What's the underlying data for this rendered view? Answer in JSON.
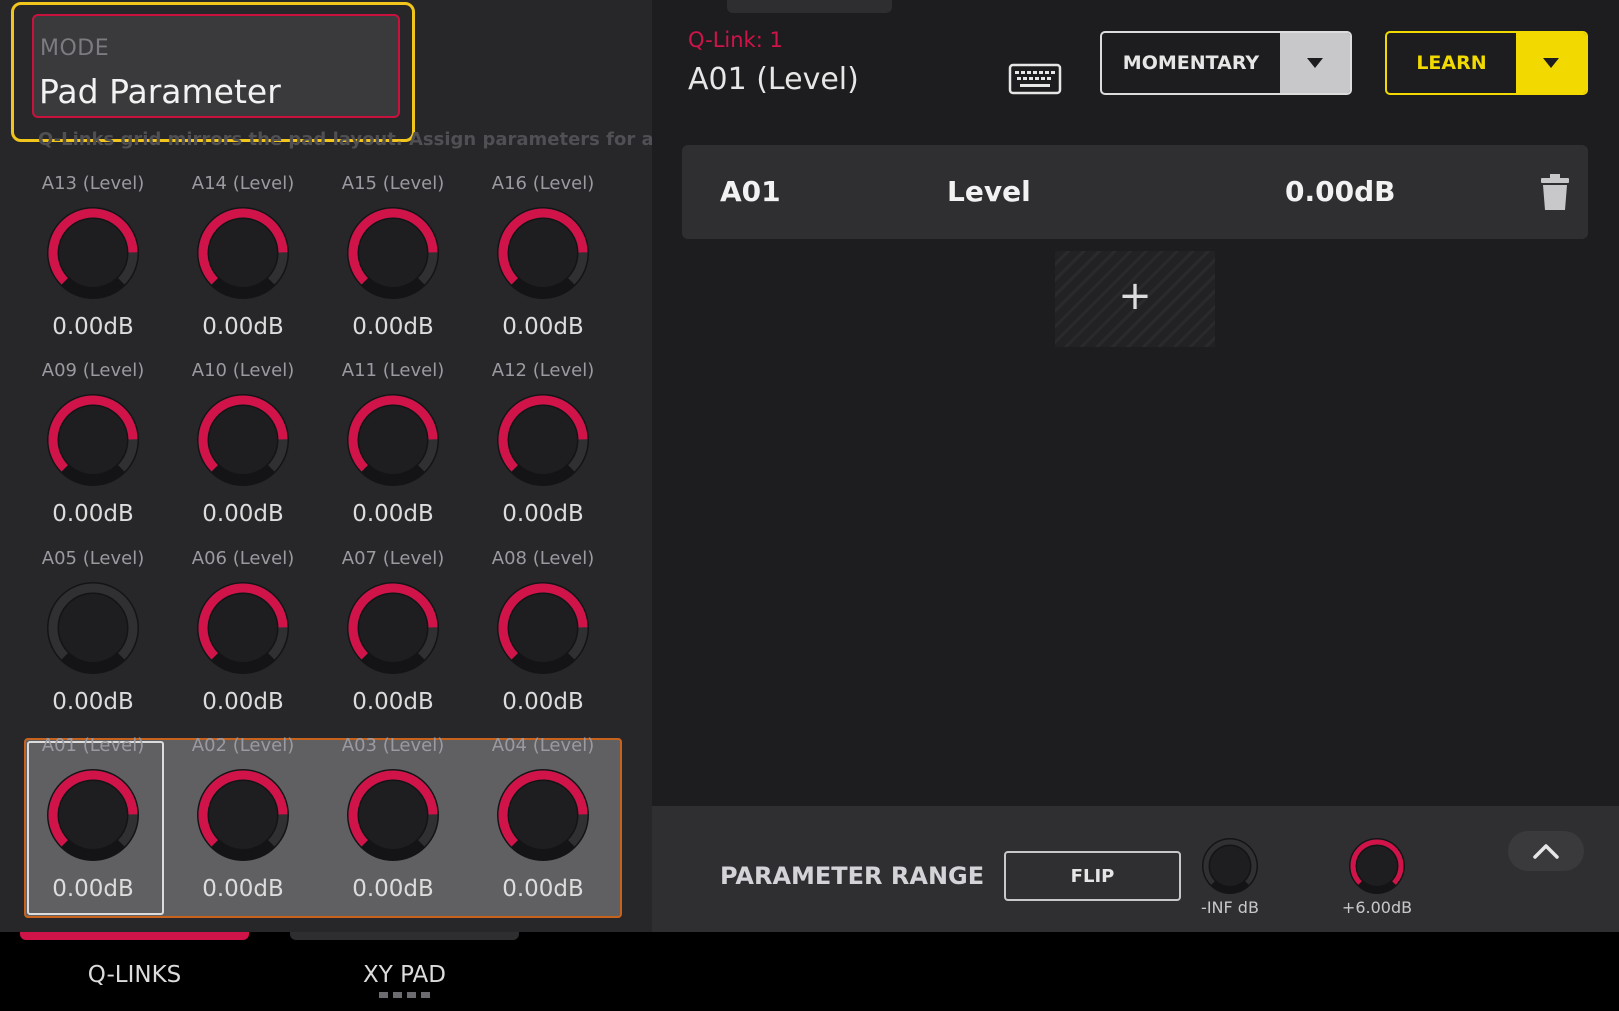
{
  "colors": {
    "accent_red": "#d0144a",
    "learn_yellow": "#f2da00",
    "highlight_yellow": "#f2c51c",
    "active_row_orange": "#c8631d"
  },
  "mode": {
    "label": "MODE",
    "value": "Pad Parameter",
    "hint": "Q-Links grid mirrors the pad layout. Assign parameters for all Q-Links"
  },
  "knob_rows": [
    [
      {
        "label": "A13 (Level)",
        "value": "0.00dB",
        "level": 0.83
      },
      {
        "label": "A14 (Level)",
        "value": "0.00dB",
        "level": 0.83
      },
      {
        "label": "A15 (Level)",
        "value": "0.00dB",
        "level": 0.83
      },
      {
        "label": "A16 (Level)",
        "value": "0.00dB",
        "level": 0.83
      }
    ],
    [
      {
        "label": "A09 (Level)",
        "value": "0.00dB",
        "level": 0.83
      },
      {
        "label": "A10 (Level)",
        "value": "0.00dB",
        "level": 0.83
      },
      {
        "label": "A11 (Level)",
        "value": "0.00dB",
        "level": 0.83
      },
      {
        "label": "A12 (Level)",
        "value": "0.00dB",
        "level": 0.83
      }
    ],
    [
      {
        "label": "A05 (Level)",
        "value": "0.00dB",
        "level": 0
      },
      {
        "label": "A06 (Level)",
        "value": "0.00dB",
        "level": 0.83
      },
      {
        "label": "A07 (Level)",
        "value": "0.00dB",
        "level": 0.83
      },
      {
        "label": "A08 (Level)",
        "value": "0.00dB",
        "level": 0.83
      }
    ],
    [
      {
        "label": "A01 (Level)",
        "value": "0.00dB",
        "level": 0.83
      },
      {
        "label": "A02 (Level)",
        "value": "0.00dB",
        "level": 0.83
      },
      {
        "label": "A03 (Level)",
        "value": "0.00dB",
        "level": 0.83
      },
      {
        "label": "A04 (Level)",
        "value": "0.00dB",
        "level": 0.83
      }
    ]
  ],
  "qlink": {
    "number_label": "Q-Link: 1",
    "name": "A01 (Level)",
    "keyboard_icon": "keyboard-icon"
  },
  "momentary": {
    "label": "MOMENTARY"
  },
  "learn": {
    "label": "LEARN"
  },
  "assignment": {
    "pad": "A01",
    "parameter": "Level",
    "value": "0.00dB"
  },
  "add_slot": {
    "label": "+"
  },
  "param_range": {
    "title": "PARAMETER RANGE",
    "flip_label": "FLIP",
    "min_label": "-INF dB",
    "min_level": 0,
    "max_label": "+6.00dB",
    "max_level": 1
  },
  "tabs": {
    "qlinks": "Q-LINKS",
    "xy_pad": "XY PAD"
  }
}
